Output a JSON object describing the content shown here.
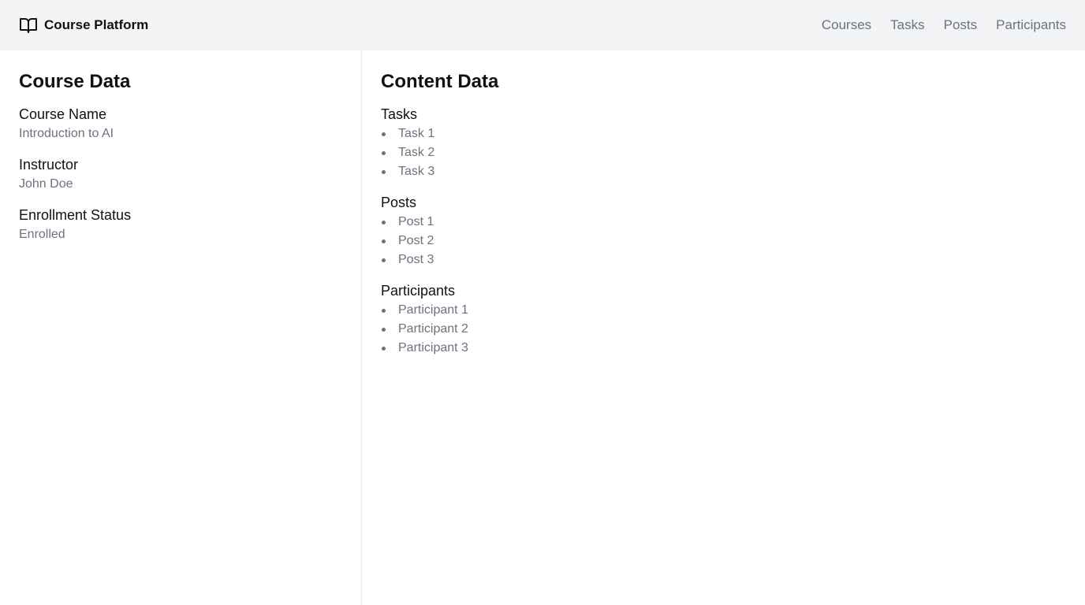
{
  "header": {
    "brand": "Course Platform",
    "nav": [
      "Courses",
      "Tasks",
      "Posts",
      "Participants"
    ]
  },
  "course_data": {
    "title": "Course Data",
    "fields": [
      {
        "label": "Course Name",
        "value": "Introduction to AI"
      },
      {
        "label": "Instructor",
        "value": "John Doe"
      },
      {
        "label": "Enrollment Status",
        "value": "Enrolled"
      }
    ]
  },
  "content_data": {
    "title": "Content Data",
    "sections": [
      {
        "title": "Tasks",
        "items": [
          "Task 1",
          "Task 2",
          "Task 3"
        ]
      },
      {
        "title": "Posts",
        "items": [
          "Post 1",
          "Post 2",
          "Post 3"
        ]
      },
      {
        "title": "Participants",
        "items": [
          "Participant 1",
          "Participant 2",
          "Participant 3"
        ]
      }
    ]
  }
}
